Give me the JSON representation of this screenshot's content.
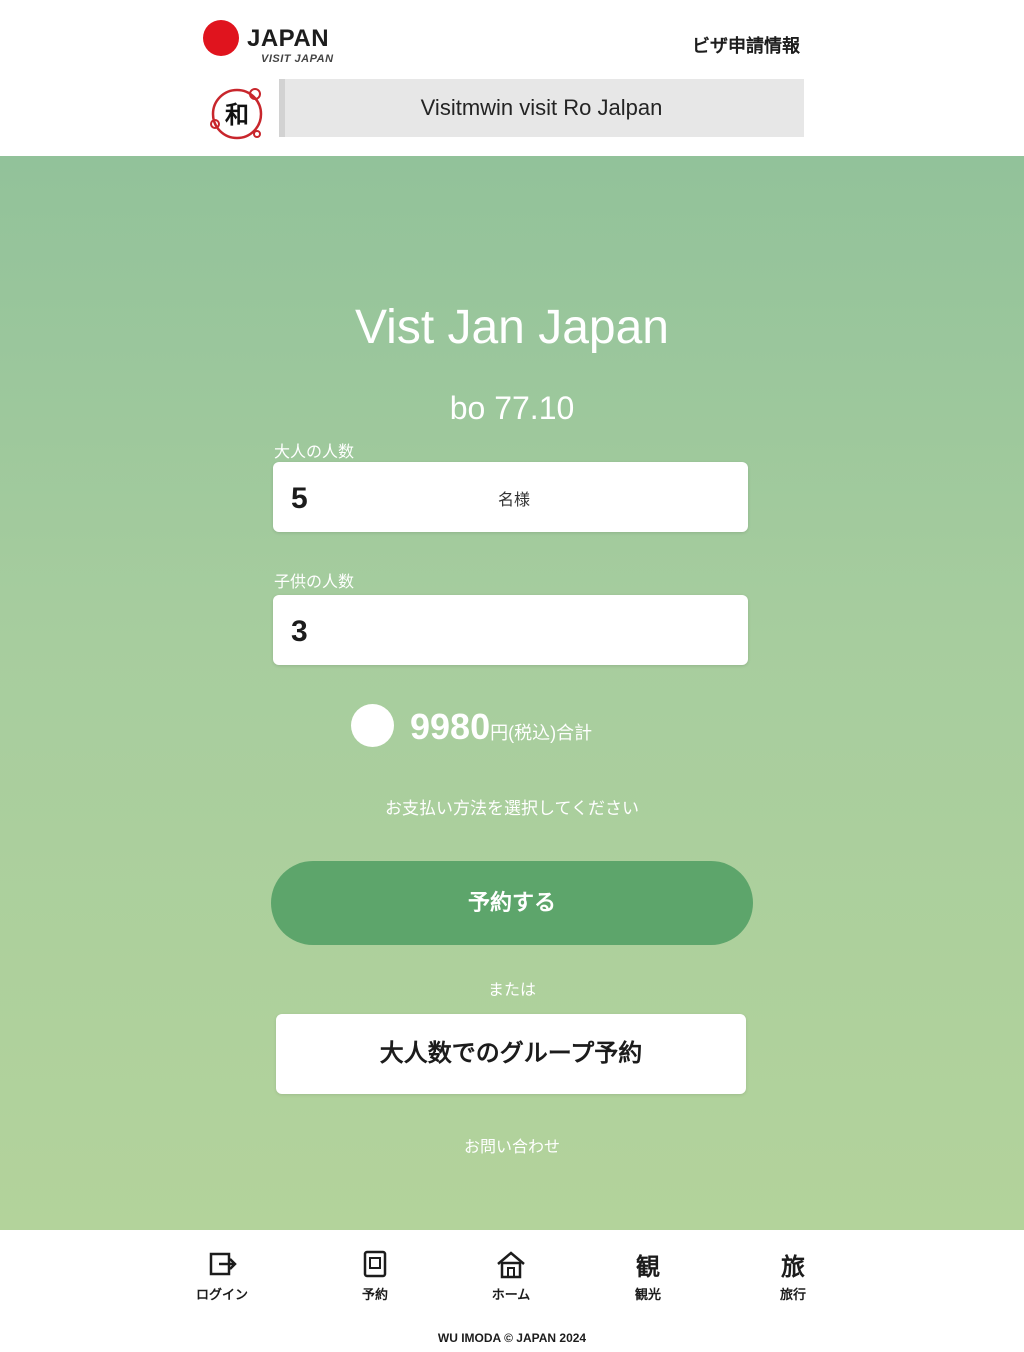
{
  "header": {
    "logo_text": "JAPAN",
    "logo_sub": "VISIT JAPAN",
    "top_link": "ビザ申請情報",
    "seal_glyph": "和",
    "banner_text": "Visitmwin visit Ro Jalpan"
  },
  "main": {
    "title": "Vist Jan Japan",
    "subtitle": "bo 77.10",
    "field1": {
      "label": "大人の人数",
      "value": "5",
      "unit": "名様"
    },
    "field2": {
      "label": "子供の人数",
      "value": "3"
    },
    "total": {
      "value": "9980",
      "unit": "円(税込)合計"
    },
    "note": "お支払い方法を選択してください",
    "primary_button": "予約する",
    "or": "または",
    "secondary_button": "大人数でのグループ予約",
    "footer_link": "お問い合わせ"
  },
  "nav": {
    "items": [
      {
        "label": "ログイン",
        "icon": "login-icon"
      },
      {
        "label": "予約",
        "icon": "document-icon"
      },
      {
        "label": "ホーム",
        "icon": "home-icon"
      },
      {
        "label": "観光",
        "icon": "kanji-icon"
      },
      {
        "label": "旅行",
        "icon": "kanji-icon"
      }
    ],
    "glyph_kanji_1": "観",
    "glyph_kanji_2": "旅",
    "copyright": "WU IMODA © JAPAN 2024"
  },
  "colors": {
    "accent_red": "#e0141e",
    "green_top": "#92c29a",
    "green_bottom": "#b3d39b",
    "button_green": "#5da56b"
  }
}
